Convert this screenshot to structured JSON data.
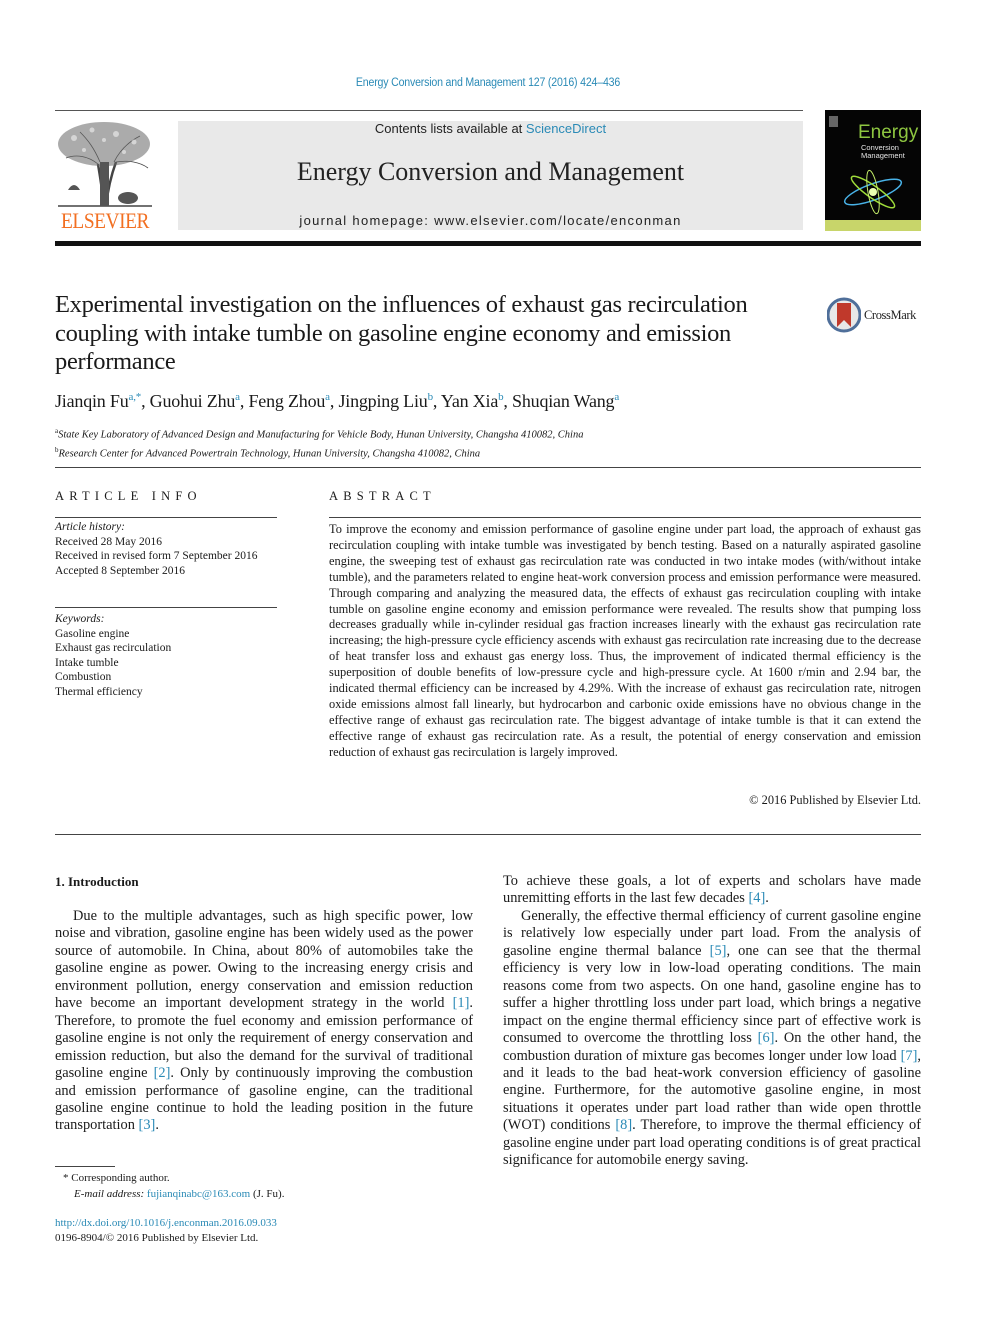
{
  "header": {
    "journal_ref": "Energy Conversion and Management 127 (2016) 424–436",
    "contents_prefix": "Contents lists available at ",
    "contents_link": "ScienceDirect",
    "journal_title": "Energy Conversion and Management",
    "homepage": "journal homepage: www.elsevier.com/locate/enconman",
    "publisher_logo_text": "ELSEVIER",
    "cover": {
      "line1": "Energy",
      "line2": "Conversion",
      "line3": "Management"
    },
    "crossmark_label": "CrossMark"
  },
  "article": {
    "title": "Experimental investigation on the influences of exhaust gas recirculation coupling with intake tumble on gasoline engine economy and emission performance",
    "authors": [
      {
        "name": "Jianqin Fu",
        "sup": "a,*"
      },
      {
        "name": "Guohui Zhu",
        "sup": "a"
      },
      {
        "name": "Feng Zhou",
        "sup": "a"
      },
      {
        "name": "Jingping Liu",
        "sup": "b"
      },
      {
        "name": "Yan Xia",
        "sup": "b"
      },
      {
        "name": "Shuqian Wang",
        "sup": "a"
      }
    ],
    "affiliations": [
      {
        "mark": "a",
        "text": "State Key Laboratory of Advanced Design and Manufacturing for Vehicle Body, Hunan University, Changsha 410082, China"
      },
      {
        "mark": "b",
        "text": "Research Center for Advanced Powertrain Technology, Hunan University, Changsha 410082, China"
      }
    ]
  },
  "article_info": {
    "heading": "ARTICLE INFO",
    "history_label": "Article history:",
    "history": [
      "Received 28 May 2016",
      "Received in revised form 7 September 2016",
      "Accepted 8 September 2016"
    ],
    "keywords_label": "Keywords:",
    "keywords": [
      "Gasoline engine",
      "Exhaust gas recirculation",
      "Intake tumble",
      "Combustion",
      "Thermal efficiency"
    ]
  },
  "abstract": {
    "heading": "ABSTRACT",
    "text": "To improve the economy and emission performance of gasoline engine under part load, the approach of exhaust gas recirculation coupling with intake tumble was investigated by bench testing. Based on a nat­urally aspirated gasoline engine, the sweeping test of exhaust gas recirculation rate was conducted in two intake modes (with/without intake tumble), and the parameters related to engine heat-work conversion process and emission performance were measured. Through comparing and analyzing the measured data, the effects of exhaust gas recirculation coupling with intake tumble on gasoline engine economy and emission performance were revealed. The results show that pumping loss decreases gradually while in-cylinder residual gas fraction increases linearly with the exhaust gas recirculation rate increasing; the high-pressure cycle efficiency ascends with exhaust gas recirculation rate increasing due to the decrease of heat transfer loss and exhaust gas energy loss. Thus, the improvement of indicated thermal efficiency is the superposition of double benefits of low-pressure cycle and high-pressure cycle. At 1600 r/min and 2.94 bar, the indicated thermal efficiency can be increased by 4.29%. With the increase of exhaust gas recirculation rate, nitrogen oxide emissions almost fall linearly, but hydrocarbon and carbonic oxide emissions have no obvious change in the effective range of exhaust gas recirculation rate. The biggest advantage of intake tumble is that it can extend the effective range of exhaust gas recirculation rate. As a result, the potential of energy conservation and emission reduction of exhaust gas recirculation is largely improved.",
    "copyright": "© 2016 Published by Elsevier Ltd."
  },
  "introduction": {
    "heading": "1. Introduction",
    "p1": [
      {
        "t": "Due to the multiple advantages, such as high specific power, low noise and vibration, gasoline engine has been widely used as the power source of automobile. In China, about 80% of automo­biles take the gasoline engine as power. Owing to the increasing energy crisis and environment pollution, energy conservation and emission reduction have become an important development strat­egy in the world "
      },
      {
        "ref": "[1]"
      },
      {
        "t": ". Therefore, to promote the fuel economy and emission performance of gasoline engine is not only the require­ment of energy conservation and emission reduction, but also the demand for the survival of traditional gasoline engine "
      },
      {
        "ref": "[2]"
      },
      {
        "t": ". Only by continuously improving the combustion and emission perfor­mance of gasoline engine, can the traditional gasoline engine con­tinue to hold the leading position in the future transportation "
      },
      {
        "ref": "[3]"
      },
      {
        "t": "."
      }
    ],
    "p1_cont": [
      {
        "t": "To achieve these goals, a lot of experts and scholars have made unremitting efforts in the last few decades "
      },
      {
        "ref": "[4]"
      },
      {
        "t": "."
      }
    ],
    "p2": [
      {
        "t": "Generally, the effective thermal efficiency of current gasoline engine is relatively low especially under part load. From the anal­ysis of gasoline engine thermal balance "
      },
      {
        "ref": "[5]"
      },
      {
        "t": ", one can see that the thermal efficiency is very low in low-load operating conditions. The main reasons come from two aspects. On one hand, gasoline engine has to suffer a higher throttling loss under part load, which brings a negative impact on the engine thermal efficiency since part of effective work is consumed to overcome the throttling loss "
      },
      {
        "ref": "[6]"
      },
      {
        "t": ". On the other hand, the combustion duration of mixture gas becomes longer under low load "
      },
      {
        "ref": "[7]"
      },
      {
        "t": ", and it leads to the bad heat-work conversion efficiency of gasoline engine. Furthermore, for the automotive gasoline engine, in most situations it operates under part load rather than wide open throttle (WOT) conditions "
      },
      {
        "ref": "[8]"
      },
      {
        "t": ". Therefore, to improve the thermal efficiency of gasoline engine under part load operating conditions is of great practical signifi­cance for automobile energy saving."
      }
    ]
  },
  "footnotes": {
    "corresponding": "* Corresponding author.",
    "email_label": "E-mail address: ",
    "email": "fujianqinabc@163.com",
    "email_suffix": " (J. Fu).",
    "doi": "http://dx.doi.org/10.1016/j.enconman.2016.09.033",
    "issn_line": "0196-8904/© 2016 Published by Elsevier Ltd."
  },
  "colors": {
    "link": "#2a8ab6",
    "elsevier_orange": "#f26f21",
    "masthead_bg": "#e9e9e9"
  }
}
